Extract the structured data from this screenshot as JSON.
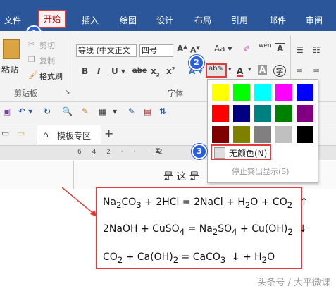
{
  "ribbon_tabs": [
    "文件",
    "开始",
    "插入",
    "绘图",
    "设计",
    "布局",
    "引用",
    "邮件",
    "审阅"
  ],
  "clipboard": {
    "paste_label": "粘贴",
    "cut_label": "剪切",
    "copy_label": "复制",
    "format_painter_label": "格式刷",
    "group_label": "剪贴板"
  },
  "font": {
    "font_name": "等线 (中文正文",
    "font_size": "四号",
    "group_label": "字体"
  },
  "tabs2": {
    "template_label": "模板专区"
  },
  "badges": [
    "1",
    "2",
    "3"
  ],
  "highlight_menu": {
    "swatches": [
      "#ffff00",
      "#00ff00",
      "#00ffff",
      "#ff00ff",
      "#0000ff",
      "#ff0000",
      "#000080",
      "#008080",
      "#008000",
      "#800080",
      "#800000",
      "#808000",
      "#808080",
      "#c0c0c0",
      "#000000"
    ],
    "no_color_label": "无颜色(N)",
    "stop_label": "停止突出显示(S)"
  },
  "doc_fragment": "是   这 是",
  "equations": {
    "eq1": {
      "a": "Na",
      "a_sub": "2",
      "b": "CO",
      "b_sub": "3",
      "rest": " + 2HCl = 2NaCl + H",
      "h_sub": "2",
      "rest2": "O + CO",
      "co_sub": "2",
      "arrow": "↑"
    },
    "eq2": {
      "a": "2NaOH + CuSO",
      "a_sub": "4",
      "b": " = Na",
      "b_sub": "2",
      "c": "SO",
      "c_sub": "4",
      "d": " + Cu(OH)",
      "d_sub": "2",
      "arrow": "↓"
    },
    "eq3": {
      "a": "CO",
      "a_sub": "2",
      "b": " + Ca(OH)",
      "b_sub": "2",
      "c": " = CaCO",
      "c_sub": "3",
      "arrow": "↓",
      "d": "  + H",
      "d_sub": "2",
      "e": "O"
    }
  },
  "watermark": "头条号 / 大平微课",
  "colors": {
    "ribbon_blue": "#2b579a",
    "badge_blue": "#2b5fd9",
    "annotation_red": "#e23b3b"
  }
}
